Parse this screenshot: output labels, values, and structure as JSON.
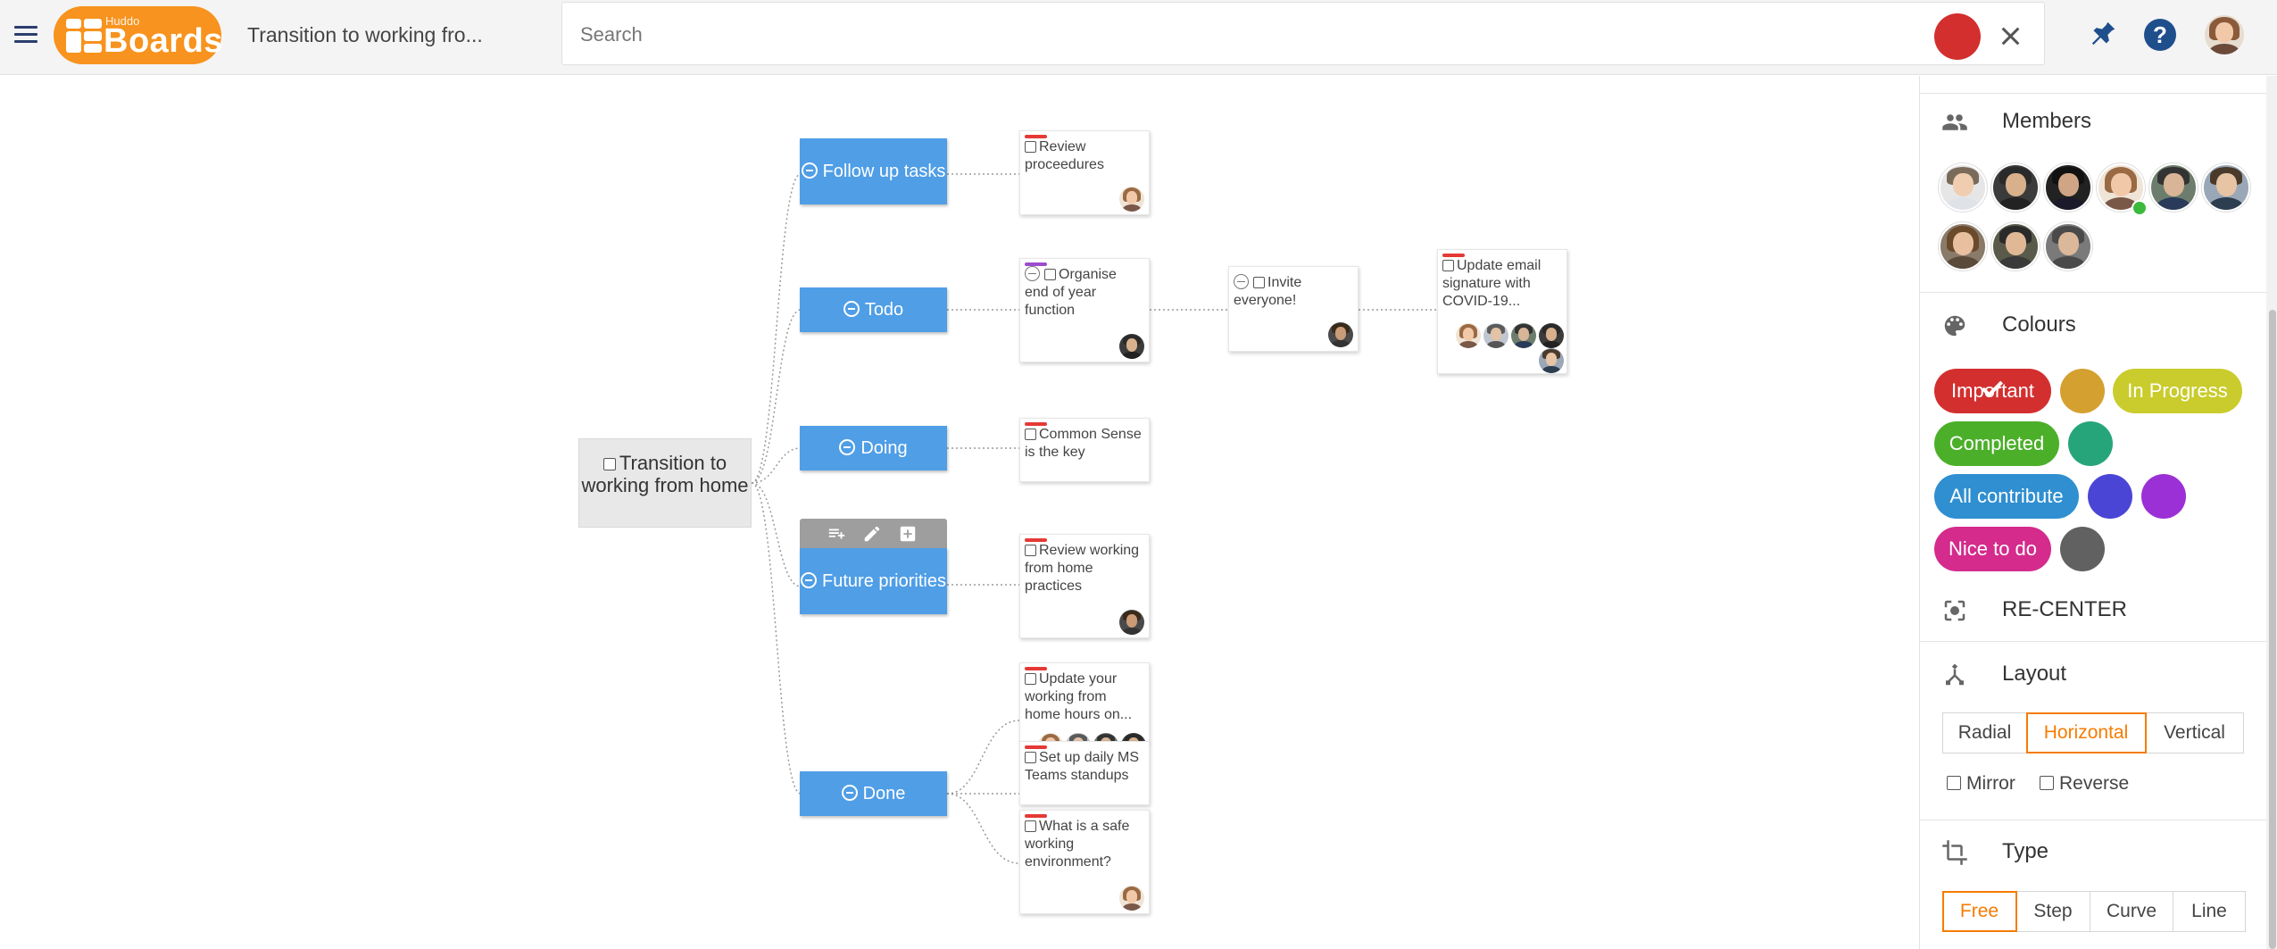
{
  "header": {
    "logo_small": "Huddo",
    "logo_big": "Boards",
    "board_title": "Transition to working fro...",
    "search_placeholder": "Search",
    "help_label": "?"
  },
  "colors": {
    "list_node": "#4f9ee6",
    "root_node": "#e8e8e8",
    "accent_orange": "#f57c00",
    "record_red": "#d32f2f",
    "tag_red": "#e53935",
    "tag_purple": "#9c4dcc"
  },
  "board": {
    "root": {
      "label": "Transition to working from home"
    },
    "lists": [
      {
        "id": "follow-up",
        "label": "Follow up tasks"
      },
      {
        "id": "todo",
        "label": "Todo"
      },
      {
        "id": "doing",
        "label": "Doing"
      },
      {
        "id": "future",
        "label": "Future priorities"
      },
      {
        "id": "done",
        "label": "Done"
      }
    ],
    "toolbar_icons": [
      "add-list-icon",
      "edit-icon",
      "add-card-icon"
    ],
    "cards": [
      {
        "id": "review-proc",
        "title": "Review proceedures",
        "tag": "red"
      },
      {
        "id": "organise",
        "title": "Organise end of year function",
        "tag": "purple"
      },
      {
        "id": "invite",
        "title": "Invite everyone!"
      },
      {
        "id": "email-sig",
        "title": "Update email signature with COVID-19...",
        "tag": "red"
      },
      {
        "id": "common-sense",
        "title": "Common Sense is the key",
        "tag": "red"
      },
      {
        "id": "review-wfh",
        "title": "Review working from home practices",
        "tag": "red"
      },
      {
        "id": "update-hours",
        "title": "Update your working from home hours on...",
        "tag": "red"
      },
      {
        "id": "teams-standups",
        "title": "Set up daily MS Teams standups",
        "tag": "red"
      },
      {
        "id": "safe-env",
        "title": "What is a safe working environment?",
        "tag": "red"
      }
    ]
  },
  "panel": {
    "members_title": "Members",
    "colours_title": "Colours",
    "colour_pills": [
      {
        "label": "Important",
        "color": "#d32f2f",
        "selected": true
      },
      {
        "label": "",
        "color": "#d4a030"
      },
      {
        "label": "In Progress",
        "color": "#c9cc2c"
      },
      {
        "label": "Completed",
        "color": "#4caf2a"
      },
      {
        "label": "",
        "color": "#26a57a"
      },
      {
        "label": "All contribute",
        "color": "#2f8fd0"
      },
      {
        "label": "",
        "color": "#4b45d6"
      },
      {
        "label": "",
        "color": "#9b30d6"
      },
      {
        "label": "Nice to do",
        "color": "#d42b8c"
      },
      {
        "label": "",
        "color": "#616161"
      }
    ],
    "recenter_label": "RE-CENTER",
    "layout_title": "Layout",
    "layout_options": [
      "Radial",
      "Horizontal",
      "Vertical"
    ],
    "layout_selected": "Horizontal",
    "mirror_label": "Mirror",
    "reverse_label": "Reverse",
    "type_title": "Type",
    "type_options": [
      "Free",
      "Step",
      "Curve",
      "Line"
    ],
    "type_selected": "Free"
  }
}
